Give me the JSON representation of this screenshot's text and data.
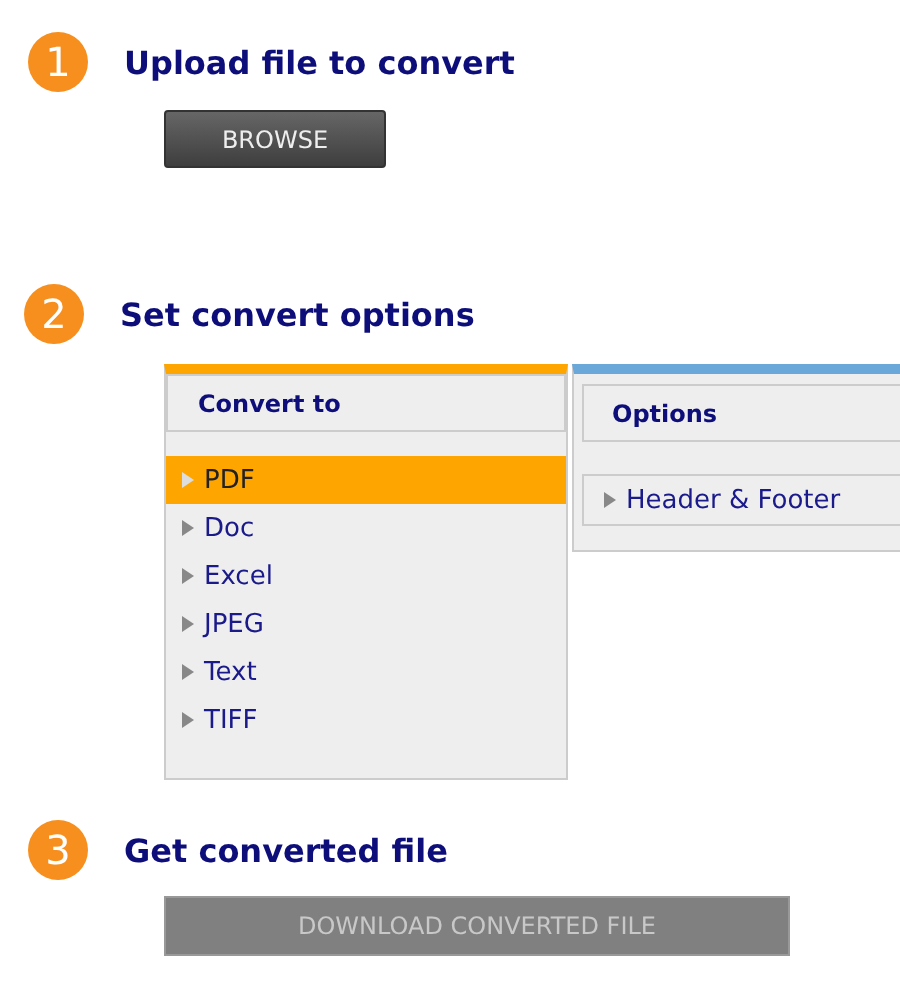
{
  "steps": [
    {
      "number": "1",
      "title": "Upload file to convert"
    },
    {
      "number": "2",
      "title": "Set convert options"
    },
    {
      "number": "3",
      "title": "Get converted file"
    }
  ],
  "browse_button": {
    "label": "BROWSE"
  },
  "convert_to": {
    "heading": "Convert to",
    "items": [
      {
        "label": "PDF",
        "selected": true
      },
      {
        "label": "Doc",
        "selected": false
      },
      {
        "label": "Excel",
        "selected": false
      },
      {
        "label": "JPEG",
        "selected": false
      },
      {
        "label": "Text",
        "selected": false
      },
      {
        "label": "TIFF",
        "selected": false
      }
    ]
  },
  "options": {
    "heading": "Options",
    "items": [
      {
        "label": "Header & Footer",
        "expanded": false
      }
    ]
  },
  "download_button": {
    "label": "DOWNLOAD CONVERTED FILE",
    "disabled": true
  }
}
